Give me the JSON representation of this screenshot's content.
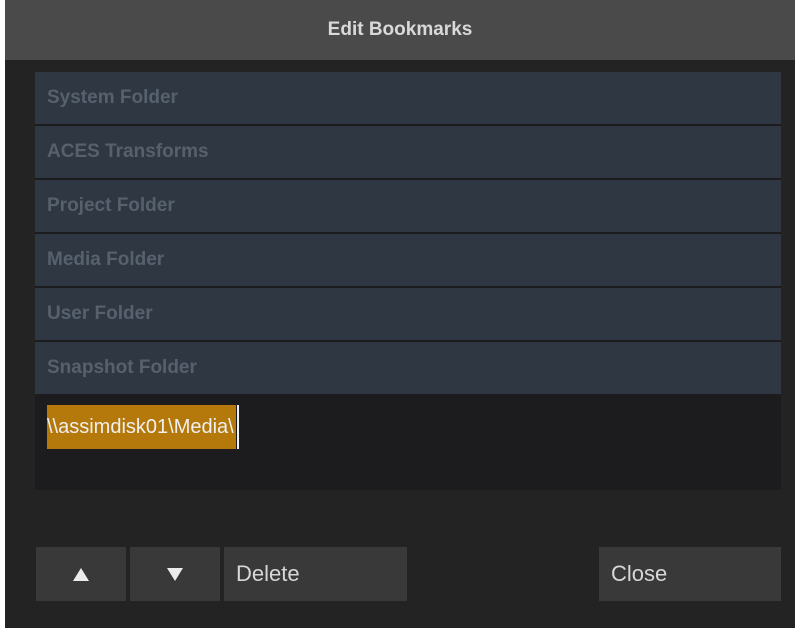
{
  "dialog": {
    "title": "Edit Bookmarks"
  },
  "bookmarks": [
    {
      "label": "System Folder"
    },
    {
      "label": "ACES Transforms"
    },
    {
      "label": "Project Folder"
    },
    {
      "label": "Media Folder"
    },
    {
      "label": "User Folder"
    },
    {
      "label": "Snapshot Folder"
    }
  ],
  "editor": {
    "value": "\\\\assimdisk01\\Media\\"
  },
  "buttons": {
    "move_up_icon": "triangle-up-icon",
    "move_down_icon": "triangle-down-icon",
    "delete_label": "Delete",
    "close_label": "Close"
  },
  "colors": {
    "title_bar": "#4a4a4a",
    "dialog_bg": "#232323",
    "bookmark_row": "#2e3742",
    "bookmark_text": "#57616d",
    "selection": "#b5780b",
    "button_bg": "#393939"
  }
}
